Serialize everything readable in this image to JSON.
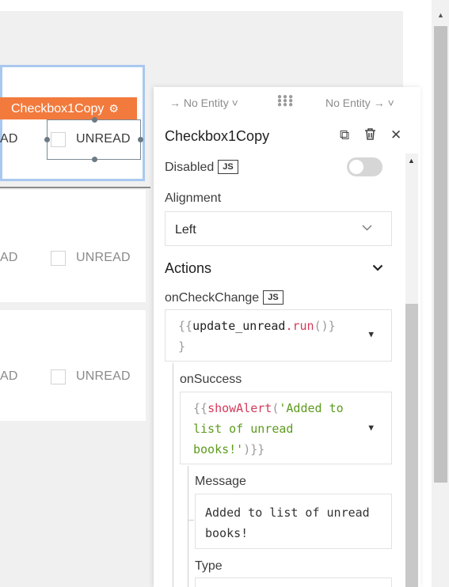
{
  "canvas": {
    "top_widget": {
      "tag_label": "Checkbox1Copy",
      "tag_icon": "gear-icon",
      "left_text": "AD",
      "checkbox_label": "UNREAD"
    },
    "rows": [
      {
        "left_text": "AD",
        "checkbox_label": "UNREAD"
      },
      {
        "left_text": "AD",
        "checkbox_label": "UNREAD"
      }
    ]
  },
  "pane": {
    "entity_left": "→ No Entity ˅",
    "entity_right": "No Entity → ˅",
    "title": "Checkbox1Copy",
    "header_icons": [
      "copy-icon",
      "delete-icon",
      "close-icon"
    ],
    "disabled": {
      "label": "Disabled",
      "badge": "JS",
      "value": false
    },
    "alignment": {
      "label": "Alignment",
      "value": "Left"
    },
    "actions": {
      "label": "Actions"
    },
    "on_check_change": {
      "label": "onCheckChange",
      "badge": "JS",
      "code_open": "{{",
      "code_fn": "update_unread",
      "code_call": ".run",
      "code_paren": "()",
      "code_close_1": "}",
      "code_close_2": "}"
    },
    "on_success": {
      "label": "onSuccess",
      "code_open": "{{",
      "code_fn": "showAlert",
      "code_paren_open": "(",
      "code_str_1": "'Added to",
      "code_str_2": "list of unread",
      "code_str_3": "books!'",
      "code_close": ")}}"
    },
    "message": {
      "label": "Message",
      "line_1": "Added to list of unread",
      "line_2": "books!"
    },
    "type": {
      "label": "Type"
    }
  },
  "colors": {
    "widget_tag": "#f27a3d",
    "selection_border": "#a8c8f0",
    "code_call": "#d23b5a",
    "code_string": "#5d9b1e"
  }
}
